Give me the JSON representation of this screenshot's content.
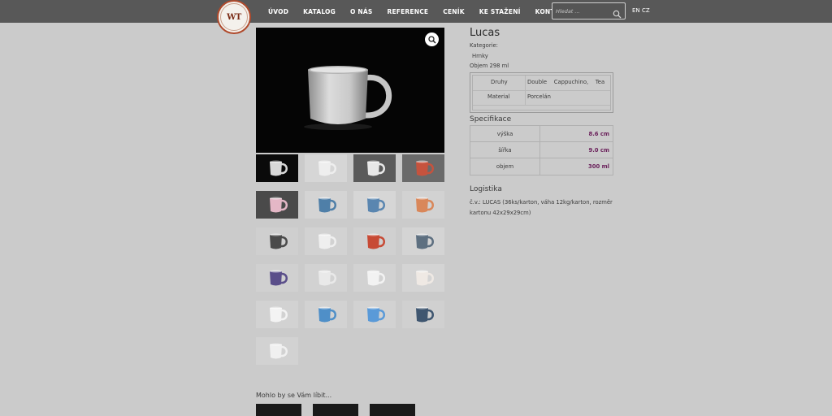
{
  "header": {
    "logo_text": "WT",
    "nav": [
      "ÚVOD",
      "KATALOG",
      "O NÁS",
      "REFERENCE",
      "CENÍK",
      "KE STAŽENÍ",
      "KONTAKT"
    ],
    "search": {
      "placeholder": "Hledat ..."
    },
    "languages": [
      "EN",
      "CZ"
    ]
  },
  "product": {
    "title": "Lucas",
    "category_label": "Kategorie:",
    "category": "Hrnky",
    "volume": "Objem 298 ml",
    "attributes": [
      {
        "name": "Druhy",
        "value": "Double    Cappuchino,    Tea"
      },
      {
        "name": "Material",
        "value": "Porcelán"
      }
    ],
    "spec_title": "Specifikace",
    "specs": [
      {
        "label": "výška",
        "value": "8.6 cm"
      },
      {
        "label": "šířka",
        "value": "9.0 cm"
      },
      {
        "label": "objem",
        "value": "300 ml"
      }
    ],
    "logistics_title": "Logistika",
    "logistics_text": "č.v.: LUCAS (36ks/karton, váha 12kg/karton, rozměr kartonu 42x29x29cm)"
  },
  "gallery": {
    "thumbnails": [
      "white-mug-black-bg",
      "mug-set-white",
      "two-white-mugs",
      "red-mug-logo",
      "pink-white-mugs",
      "blue-orange-mug",
      "blue-orange-mug-2",
      "orange-mugs-pair",
      "two-dark-mugs",
      "white-mug",
      "red-mug-print",
      "blue-grey-mug",
      "purple-mug",
      "orange-inside-mug",
      "white-print-mug",
      "orange-pattern-mug",
      "white-print-mug-2",
      "blue-pattern-mug",
      "blue-mug",
      "dark-blue-red-mugs",
      "two-white-mugs-small"
    ]
  },
  "related": {
    "title": "Mohlo by se Vám líbit..."
  },
  "colors": {
    "header_bg": "#585858",
    "page_bg": "#cbcbcb",
    "accent_value": "#6a1f5a",
    "logo_border": "#b04a2c"
  }
}
